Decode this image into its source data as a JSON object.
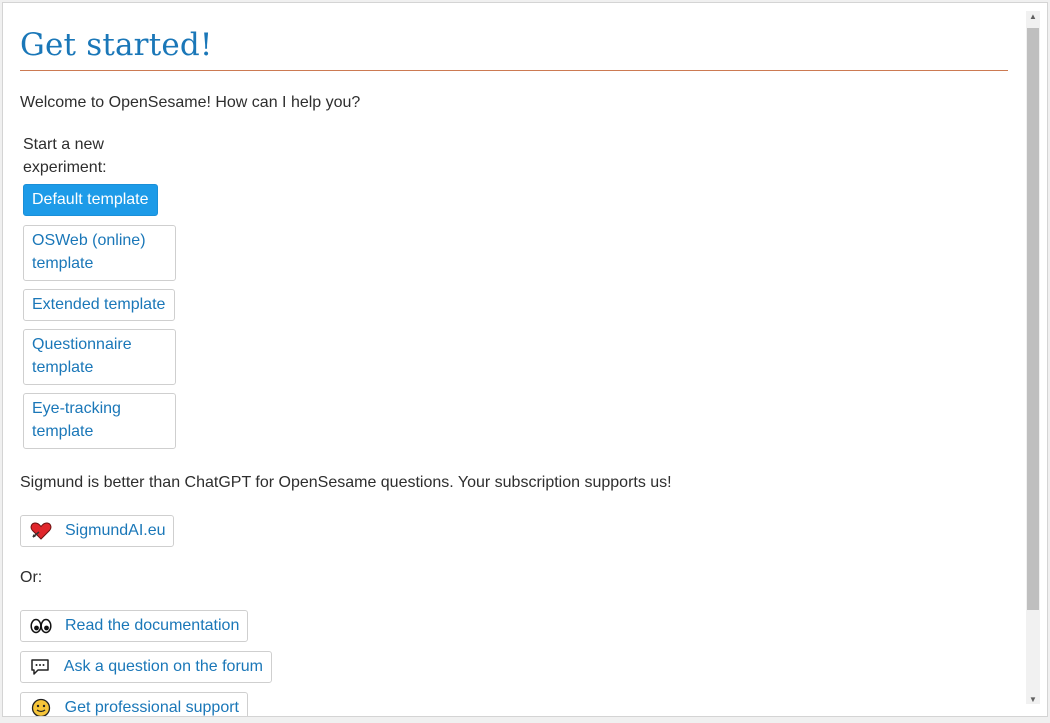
{
  "page": {
    "title": "Get started!",
    "welcome": "Welcome to OpenSesame! How can I help you?",
    "start_label": "Start a new experiment:",
    "templates": [
      {
        "label": "Default template",
        "primary": true
      },
      {
        "label": "OSWeb (online) template",
        "primary": false
      },
      {
        "label": "Extended template",
        "primary": false
      },
      {
        "label": "Questionnaire template",
        "primary": false
      },
      {
        "label": "Eye-tracking template",
        "primary": false
      }
    ],
    "sigmund_text": "Sigmund is better than ChatGPT for OpenSesame questions. Your subscription supports us!",
    "sigmund_button": {
      "label": "SigmundAI.eu",
      "icon": "heart-icon"
    },
    "or_text": "Or:",
    "links": [
      {
        "label": "Read the documentation",
        "icon": "eyes-icon"
      },
      {
        "label": "Ask a question on the forum",
        "icon": "speech-bubble-icon"
      },
      {
        "label": "Get professional support",
        "icon": "smiley-icon"
      }
    ]
  },
  "colors": {
    "accent": "#1a77b8",
    "primary_button": "#1d9be8",
    "rule": "#cc7a52"
  }
}
